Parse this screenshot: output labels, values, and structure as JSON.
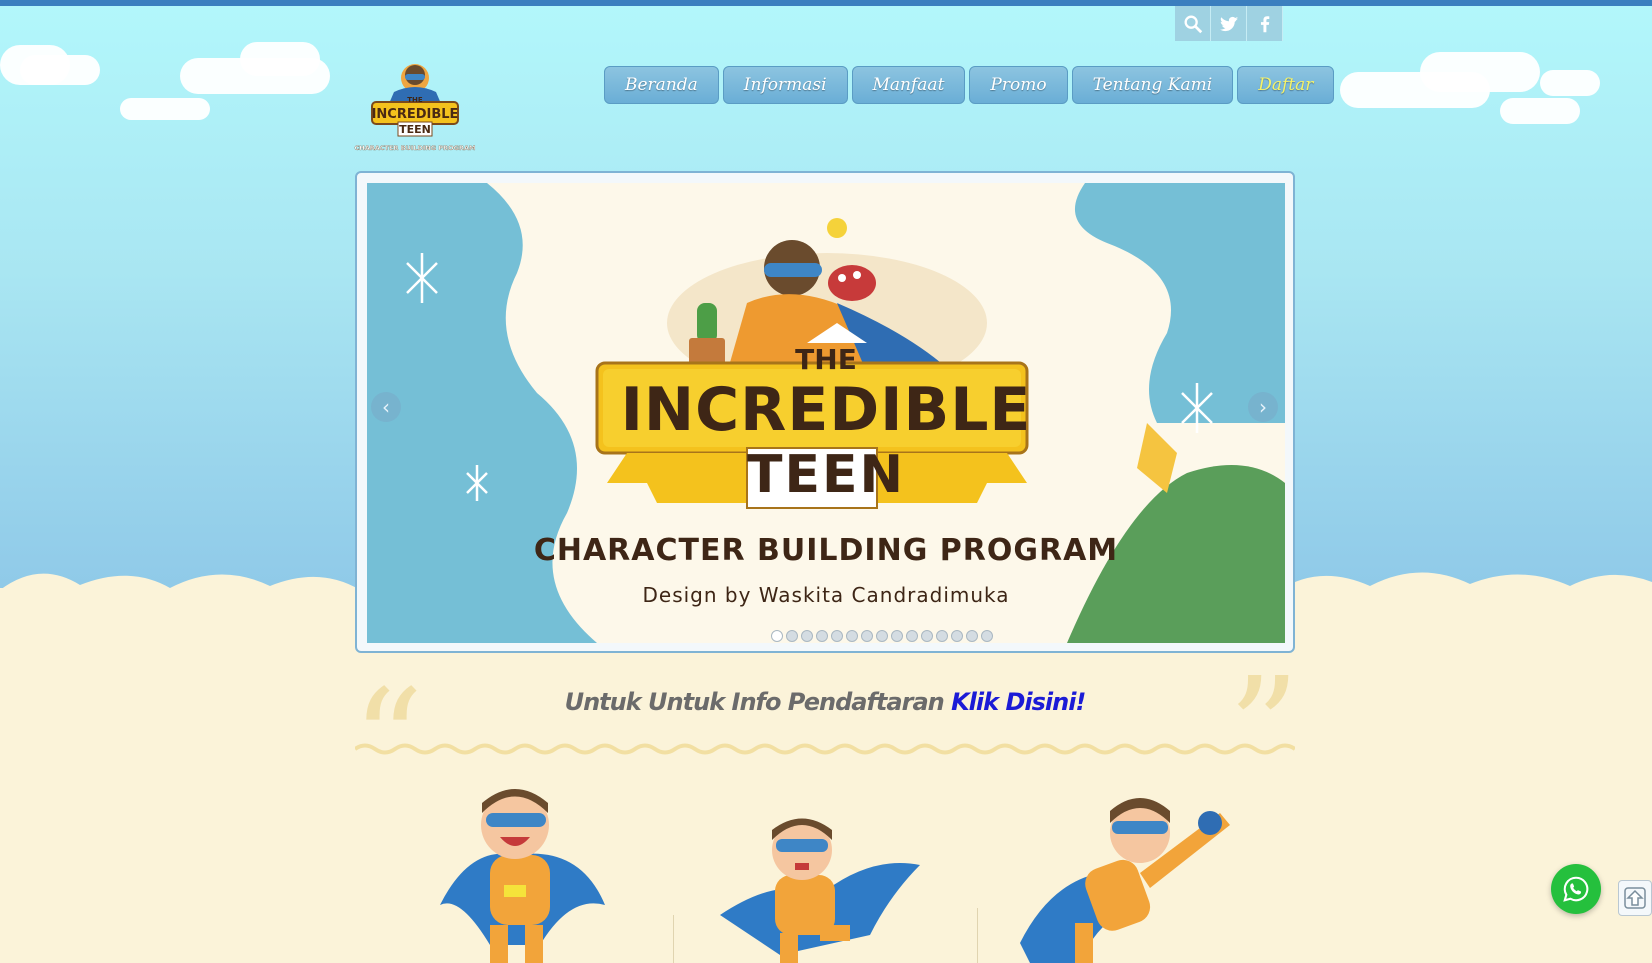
{
  "colors": {
    "accent": "#6aaed6",
    "highlight": "#f5f36a",
    "link": "#1b1bd6",
    "whatsapp": "#25c03d"
  },
  "utility_icons": [
    "search-icon",
    "twitter-icon",
    "facebook-icon"
  ],
  "logo": {
    "line1": "THE",
    "line2": "INCREDIBLE",
    "line3": "TEEN",
    "tagline": "CHARACTER BUILDING PROGRAM"
  },
  "nav": {
    "items": [
      {
        "label": "Beranda"
      },
      {
        "label": "Informasi"
      },
      {
        "label": "Manfaat"
      },
      {
        "label": "Promo"
      },
      {
        "label": "Tentang Kami"
      },
      {
        "label": "Daftar"
      }
    ]
  },
  "slider": {
    "the": "THE",
    "incredible": "INCREDIBLE",
    "teen": "TEEN",
    "subtitle": "CHARACTER BUILDING PROGRAM",
    "credit": "Design by Waskita Candradimuka",
    "prev_icon": "chevron-left-icon",
    "next_icon": "chevron-right-icon",
    "slide_count": 15,
    "active_slide": 1
  },
  "promo": {
    "text": "Untuk Untuk Info Pendaftaran",
    "link": "Klik Disini!"
  },
  "floating": {
    "whatsapp_icon": "whatsapp-icon",
    "back_to_top_icon": "arrow-up-icon"
  }
}
